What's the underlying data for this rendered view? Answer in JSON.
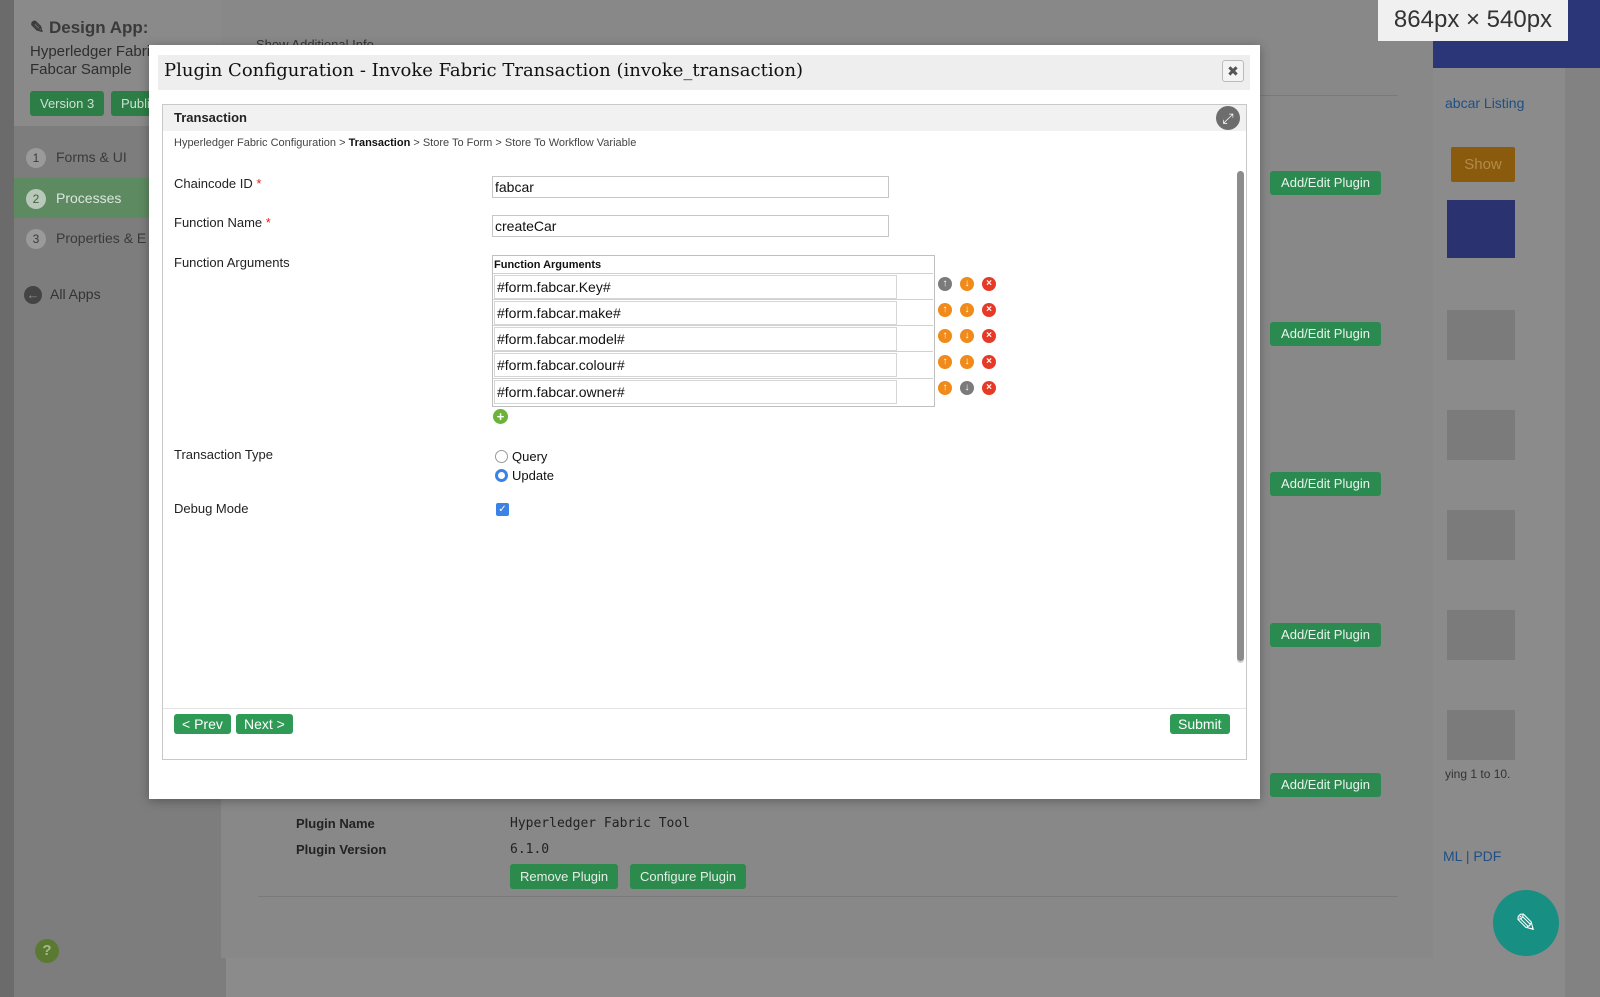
{
  "app": {
    "design_label": "Design App:",
    "name_line1": "Hyperledger Fabri",
    "name_line2": "Fabcar Sample",
    "version": "Version 3",
    "published": "Publi"
  },
  "nav": {
    "items": [
      {
        "num": "1",
        "label": "Forms & UI"
      },
      {
        "num": "2",
        "label": "Processes"
      },
      {
        "num": "3",
        "label": "Properties & E"
      }
    ],
    "all_apps": "All Apps"
  },
  "background": {
    "show_additional": "Show Additional Info",
    "add_edit_label": "Add/Edit Plugin",
    "plugin_name_label": "Plugin Name",
    "plugin_name_value": "Hyperledger Fabric Tool",
    "plugin_version_label": "Plugin Version",
    "plugin_version_value": "6.1.0",
    "remove_plugin": "Remove Plugin",
    "configure_plugin": "Configure Plugin",
    "right_link": "abcar Listing",
    "right_show": "Show",
    "right_showing": "ying 1 to 10.",
    "right_export": "ML  |  PDF",
    "size_label": "864px × 540px"
  },
  "dialog": {
    "title": "Plugin Configuration - Invoke Fabric Transaction (invoke_transaction)",
    "panel_title": "Transaction",
    "breadcrumb": {
      "part1": "Hyperledger Fabric Configuration > ",
      "current": "Transaction",
      "part3": " > Store To Form > Store To Workflow Variable"
    },
    "fields": {
      "chaincode_label": "Chaincode ID",
      "chaincode_value": "fabcar",
      "function_label": "Function Name",
      "function_value": "createCar",
      "required_mark": "*",
      "args_label": "Function Arguments",
      "args_grid_header": "Function Arguments",
      "args": [
        "#form.fabcar.Key#",
        "#form.fabcar.make#",
        "#form.fabcar.model#",
        "#form.fabcar.colour#",
        "#form.fabcar.owner#"
      ],
      "txn_type_label": "Transaction Type",
      "txn_options": [
        "Query",
        "Update"
      ],
      "txn_selected": "Update",
      "debug_label": "Debug Mode",
      "debug_checked": true
    },
    "buttons": {
      "prev": "< Prev",
      "next": "Next >",
      "submit": "Submit"
    }
  },
  "colors": {
    "accent_green": "#2e9a55",
    "radio_blue": "#3b82e6",
    "arrow_orange": "#f08a1a",
    "delete_red": "#e63a26"
  }
}
